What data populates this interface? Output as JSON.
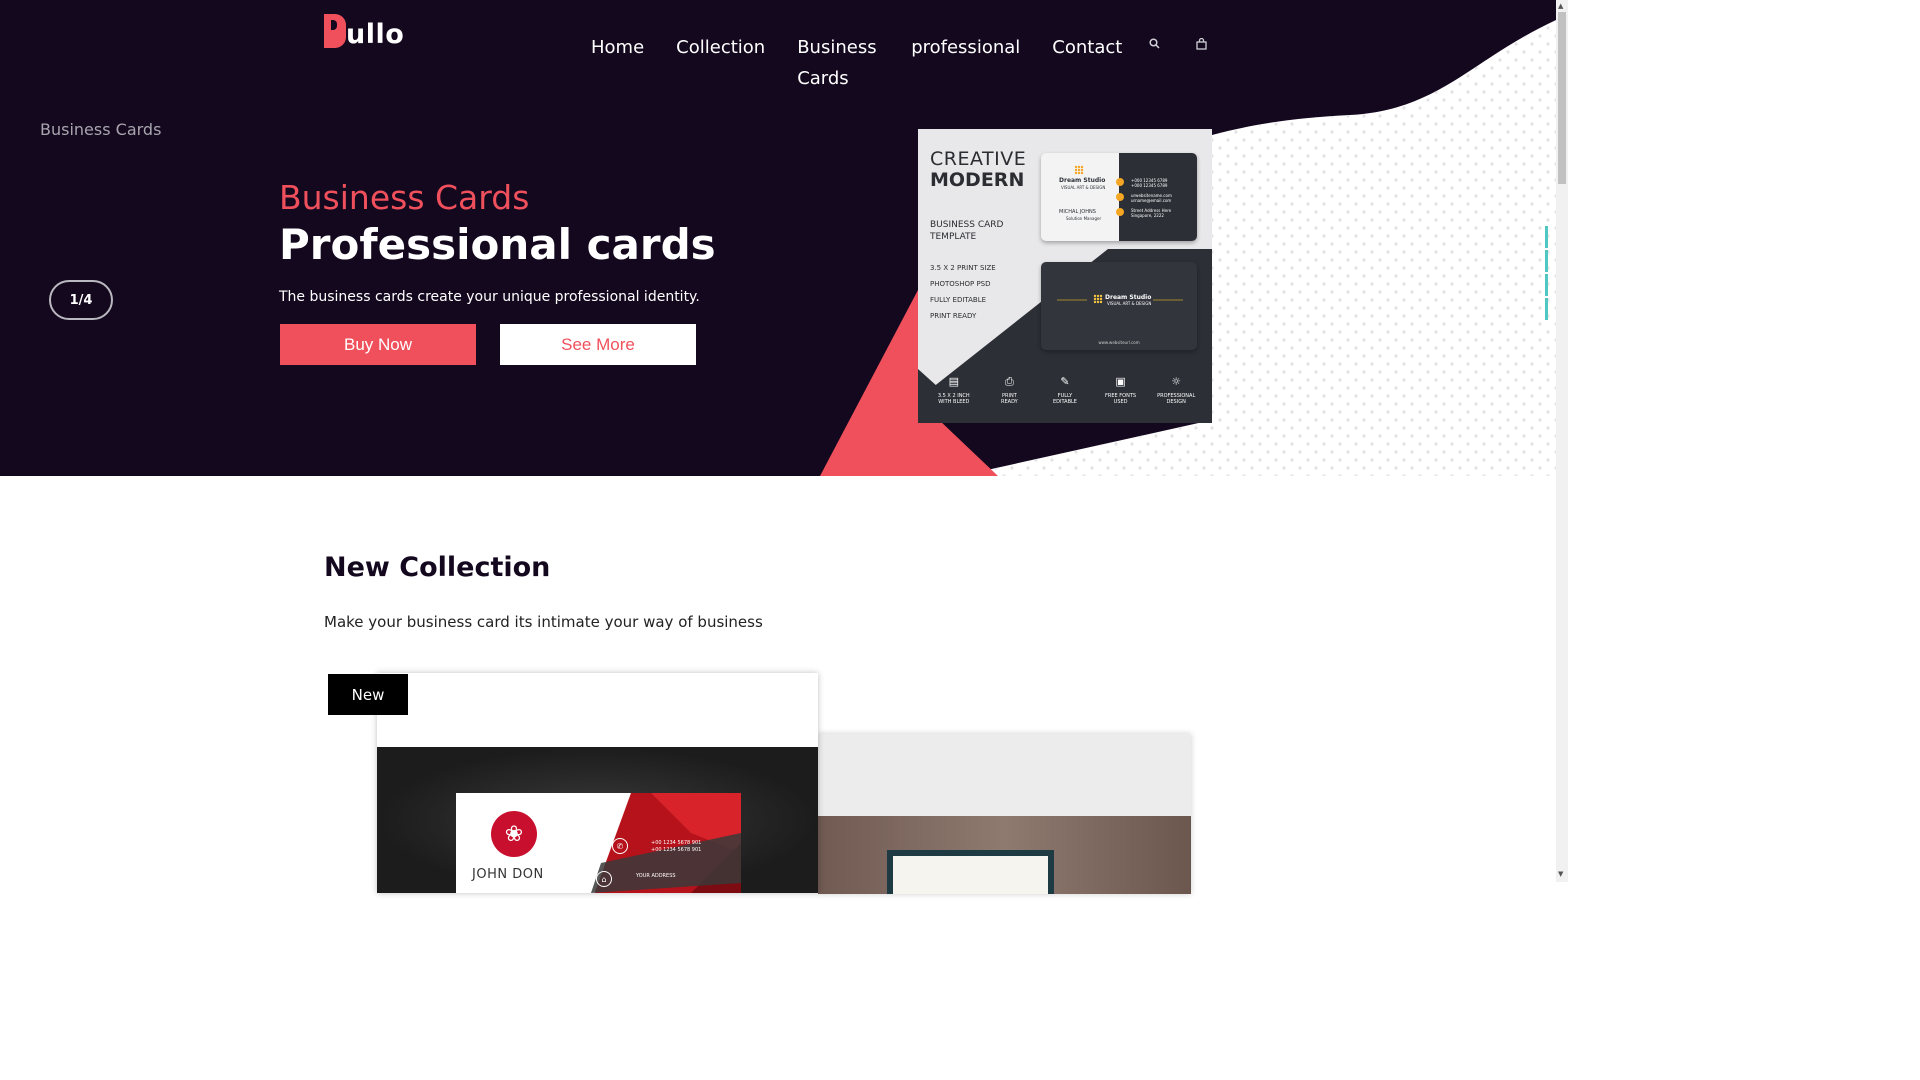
{
  "brand": {
    "logo_letter": "P",
    "logo_rest": "ullo"
  },
  "nav": {
    "items": [
      "Home",
      "Collection",
      "Business Cards",
      "professional",
      "Contact"
    ],
    "icons": [
      "search-icon",
      "bag-icon"
    ]
  },
  "hero": {
    "breadcrumb": "Business Cards",
    "slide_counter": "1/4",
    "subtitle": "Business Cards",
    "title": "Professional cards",
    "description": "The business cards create your unique professional identity.",
    "buy_label": "Buy Now",
    "more_label": "See More"
  },
  "promo": {
    "line1": "CREATIVE",
    "line2": "MODERN",
    "line3": "BUSINESS CARD TEMPLATE",
    "list": [
      "3.5 X 2 PRINT SIZE",
      "PHOTOSHOP PSD",
      "FULLY EDITABLE",
      "PRINT READY"
    ],
    "brand": "Dream Studio",
    "brand_tag": "VISUAL ART & DESIGN",
    "person": "MICHAL JOHNS",
    "person_role": "Solution Manager",
    "phone1": "+000 12345 6789",
    "phone2": "+000 12345 6789",
    "web1": "urwebsitename.com",
    "web2": "urname@email.com",
    "addr1": "Street Address Here",
    "addr2": "Singapore, 2222",
    "url": "www.websiteurl.com",
    "features": [
      {
        "icon": "document-icon",
        "glyph": "🗎",
        "l1": "3.5 X 2 INCH",
        "l2": "WITH BLEED"
      },
      {
        "icon": "printer-icon",
        "glyph": "⎙",
        "l1": "PRINT",
        "l2": "READY"
      },
      {
        "icon": "edit-icon",
        "glyph": "✎",
        "l1": "FULLY",
        "l2": "EDITABLE"
      },
      {
        "icon": "font-icon",
        "glyph": "🗚",
        "l1": "FREE FONTS",
        "l2": "USED"
      },
      {
        "icon": "bulb-icon",
        "glyph": "💡",
        "l1": "PROFESSIONAL",
        "l2": "DESIGN"
      }
    ]
  },
  "collection": {
    "title": "New Collection",
    "subtitle": "Make your business card its intimate your way of business",
    "badge": "New",
    "card1": {
      "name": "JOHN DON",
      "phone1": "+00 1234 5678 901",
      "phone2": "+00 1234 5678 901",
      "address": "YOUR ADDRESS"
    }
  },
  "colors": {
    "hero_bg": "#14081f",
    "accent": "#f0505c",
    "teal": "#4fc7c2"
  }
}
